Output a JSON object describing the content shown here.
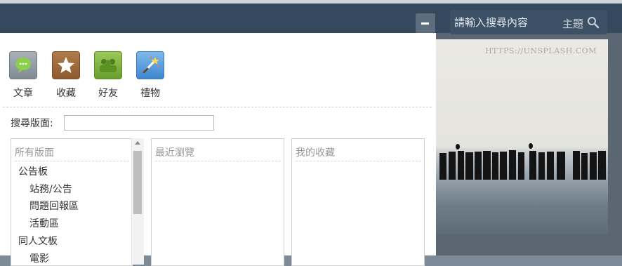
{
  "header": {
    "search_placeholder": "請輸入搜尋內容",
    "search_scope": "主題"
  },
  "photo": {
    "caption": "HTTPS://UNSPLASH.COM"
  },
  "quick_links": [
    {
      "label": "文章",
      "icon": "speech-bubble-icon"
    },
    {
      "label": "收藏",
      "icon": "star-icon"
    },
    {
      "label": "好友",
      "icon": "friends-icon"
    },
    {
      "label": "禮物",
      "icon": "magic-wand-icon"
    }
  ],
  "board_search": {
    "label": "搜尋版面:",
    "value": ""
  },
  "all_boards": {
    "title": "所有版面",
    "items": [
      {
        "label": "公告板",
        "level": 0
      },
      {
        "label": "站務/公告",
        "level": 1
      },
      {
        "label": "問題回報區",
        "level": 1
      },
      {
        "label": "活動區",
        "level": 1
      },
      {
        "label": "同人文板",
        "level": 0
      },
      {
        "label": "電影",
        "level": 1
      }
    ]
  },
  "recent_boards": {
    "title": "最近瀏覽"
  },
  "my_favorites": {
    "title": "我的收藏"
  }
}
